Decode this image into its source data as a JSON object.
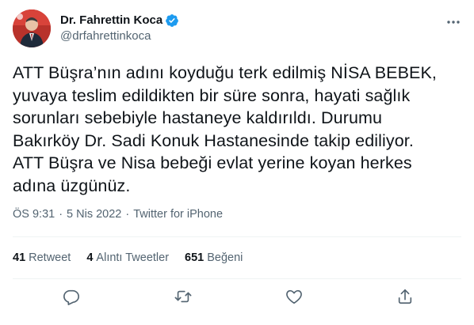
{
  "author": {
    "display_name": "Dr. Fahrettin Koca",
    "handle": "@drfahrettinkoca",
    "verified": true,
    "avatar_icon": "profile-photo"
  },
  "tweet": {
    "lines": [
      "ATT Büşra’nın adını koyduğu terk edilmiş NİSA BEBEK,",
      "yuvaya teslim edildikten bir süre sonra, hayati sağlık",
      "sorunları sebebiyle hastaneye kaldırıldı. Durumu",
      "Bakırköy Dr. Sadi Konuk Hastanesinde takip ediliyor.",
      "ATT Büşra ve Nisa bebeği evlat yerine koyan herkes",
      "adına üzgünüz."
    ]
  },
  "meta": {
    "time": "ÖS 9:31",
    "date": "5 Nis 2022",
    "source": "Twitter for iPhone",
    "separator": "·"
  },
  "stats": {
    "retweets": {
      "count": "41",
      "label": "Retweet"
    },
    "quotes": {
      "count": "4",
      "label": "Alıntı Tweetler"
    },
    "likes": {
      "count": "651",
      "label": "Beğeni"
    }
  },
  "icons": {
    "more": "more-dots-icon",
    "reply": "reply-icon",
    "retweet": "retweet-icon",
    "like": "heart-icon",
    "share": "share-icon",
    "verified": "verified-badge-icon"
  },
  "colors": {
    "text": "#0f1419",
    "secondary": "#536471",
    "verified_blue": "#1d9bf0",
    "divider": "#eff3f4"
  }
}
